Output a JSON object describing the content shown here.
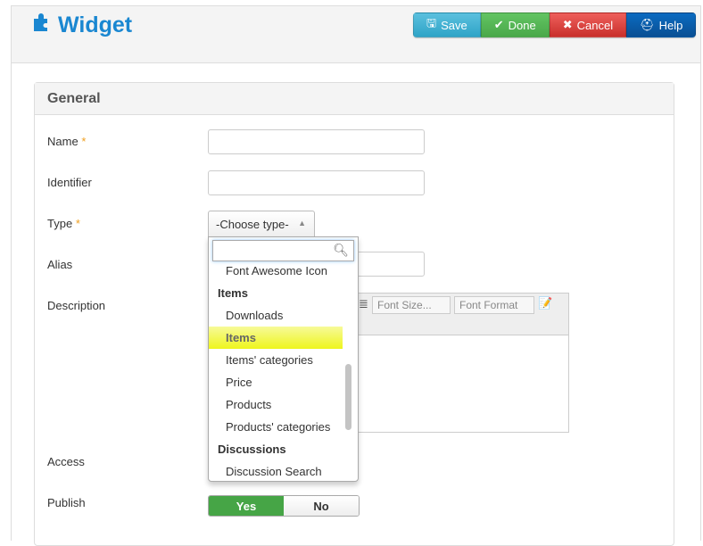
{
  "header": {
    "title": "Widget",
    "buttons": {
      "save": "Save",
      "done": "Done",
      "cancel": "Cancel",
      "help": "Help"
    }
  },
  "panel": {
    "title": "General"
  },
  "form": {
    "name_label": "Name",
    "identifier_label": "Identifier",
    "type_label": "Type",
    "alias_label": "Alias",
    "description_label": "Description",
    "access_label": "Access",
    "publish_label": "Publish",
    "required_mark": "*",
    "type_selected": "-Choose type-",
    "publish": {
      "yes": "Yes",
      "no": "No",
      "value": "Yes"
    }
  },
  "dropdown": {
    "search_value": "",
    "options": [
      {
        "label": "Font Awesome Icon",
        "kind": "option"
      },
      {
        "label": "Items",
        "kind": "group"
      },
      {
        "label": "Downloads",
        "kind": "option"
      },
      {
        "label": "Items",
        "kind": "option",
        "highlighted": true
      },
      {
        "label": "Items' categories",
        "kind": "option"
      },
      {
        "label": "Price",
        "kind": "option"
      },
      {
        "label": "Products",
        "kind": "option"
      },
      {
        "label": "Products' categories",
        "kind": "option"
      },
      {
        "label": "Discussions",
        "kind": "group"
      },
      {
        "label": "Discussion Search",
        "kind": "option"
      }
    ]
  },
  "editor": {
    "font_size": "Font Size...",
    "font_format": "Font Format"
  }
}
